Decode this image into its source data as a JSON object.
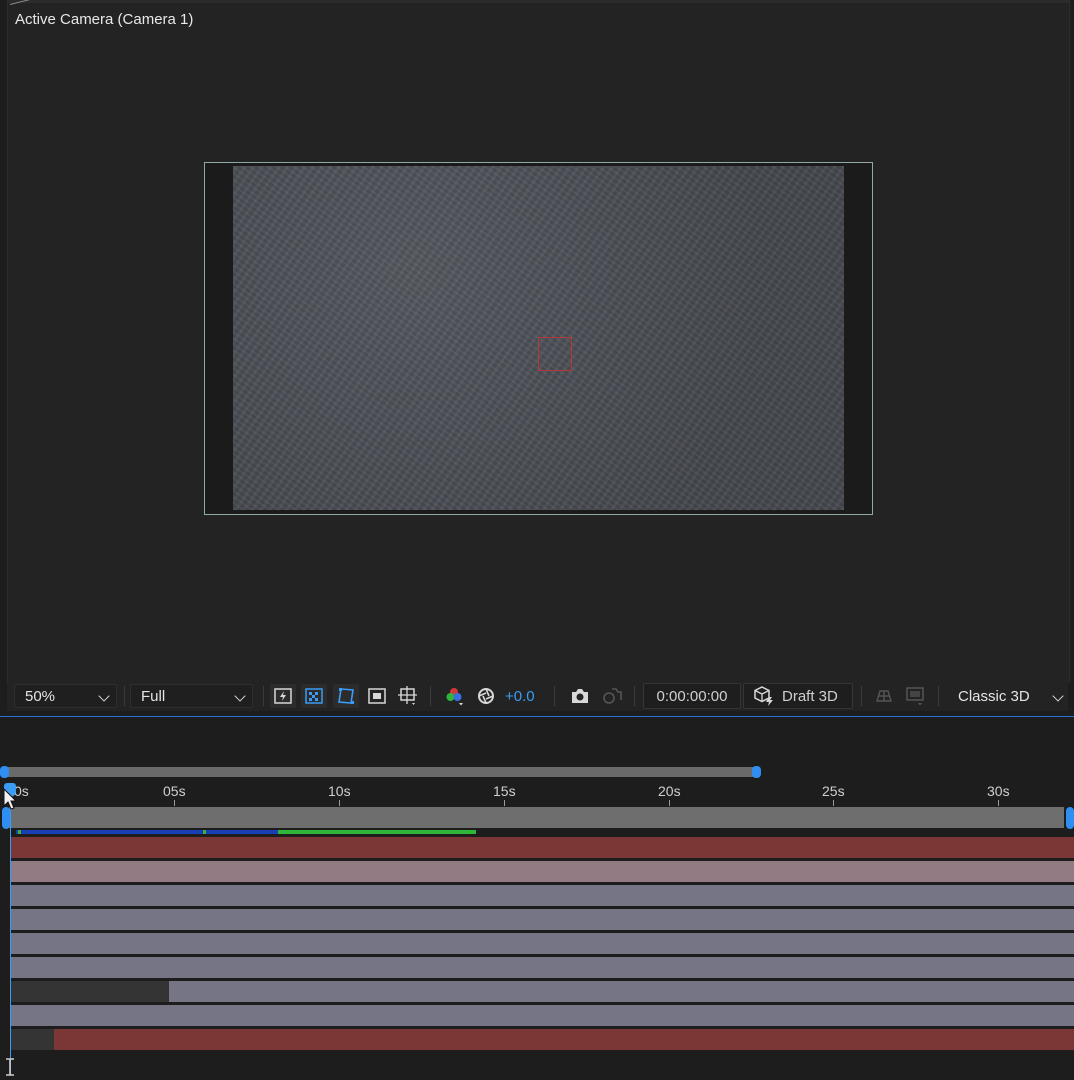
{
  "viewer": {
    "label": "Active Camera (Camera 1)",
    "colors": {
      "frame_border": "#8fa8a8",
      "image": "#4a4e55",
      "center_box": "#b23a3a"
    }
  },
  "toolbar": {
    "zoom": "50%",
    "resolution": "Full",
    "exposure": "+0.0",
    "timecode": "0:00:00:00",
    "renderer_mode": "Draft 3D",
    "renderer": "Classic 3D",
    "icons": [
      "fast-previews-icon",
      "transparency-grid-icon",
      "mask-path-icon",
      "region-of-interest-icon",
      "grid-guides-icon",
      "color-channels-icon",
      "reset-exposure-icon",
      "snapshot-icon",
      "show-snapshot-icon",
      "3d-view-icon",
      "3d-ground-plane-icon"
    ]
  },
  "timeline": {
    "ticks": [
      "0s",
      "05s",
      "10s",
      "15s",
      "20s",
      "25s",
      "30s"
    ],
    "current_time": "0s",
    "layers": [
      {
        "color": "#7b3636",
        "start": 0
      },
      {
        "color": "#927b82",
        "start": 0
      },
      {
        "color": "#767585",
        "start": 0
      },
      {
        "color": "#767585",
        "start": 0
      },
      {
        "color": "#767585",
        "start": 0
      },
      {
        "color": "#767585",
        "start": 0
      },
      {
        "color": "#767585",
        "start": 4.8
      },
      {
        "color": "#767585",
        "start": 0
      },
      {
        "color": "#7b3636",
        "start": 1.3
      }
    ],
    "colors": {
      "accent": "#2f8ef2",
      "cached_blue": "#1a3fb5",
      "cached_green": "#2fb53a"
    }
  }
}
